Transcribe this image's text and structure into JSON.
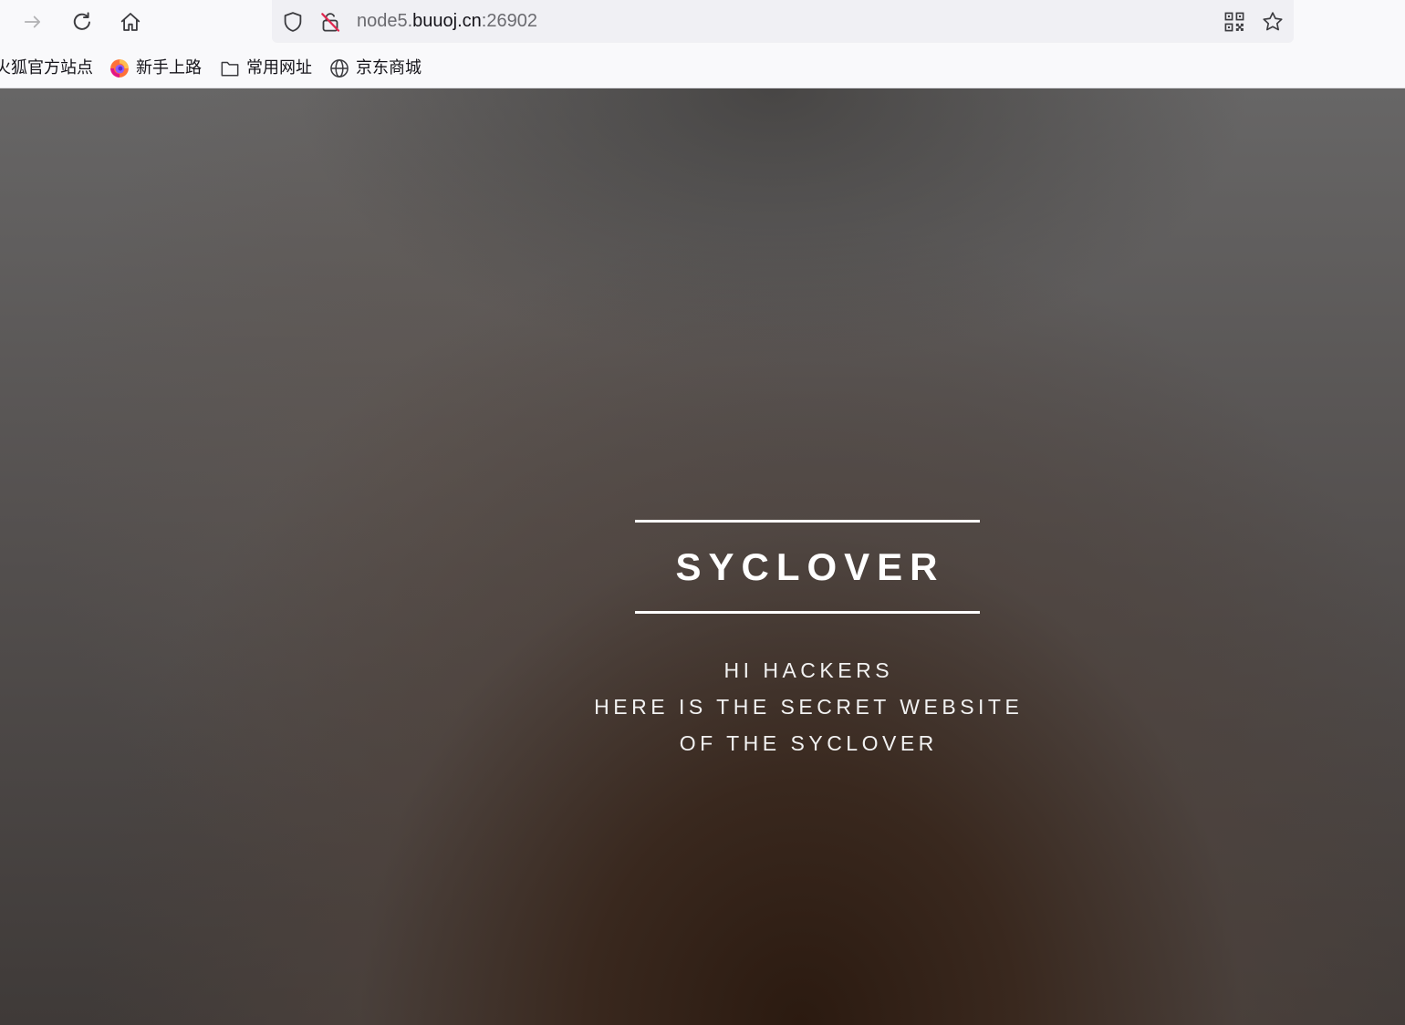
{
  "toolbar": {
    "forward": {
      "icon": "arrow-right-icon",
      "enabled": false
    },
    "reload": {
      "icon": "reload-icon"
    },
    "home": {
      "icon": "home-icon"
    }
  },
  "urlbar": {
    "tracking_icon": "shield-icon",
    "security_icon": "insecure-lock-icon",
    "url": {
      "subdomain": "node5.",
      "domain": "buuoj.cn",
      "port": ":26902"
    },
    "qr_icon": "qr-code-icon",
    "bookmark_icon": "star-icon"
  },
  "bookmarks": [
    {
      "label": "火狐官方站点"
    },
    {
      "label": "新手上路",
      "icon": "firefox-icon"
    },
    {
      "label": "常用网址",
      "icon": "folder-icon"
    },
    {
      "label": "京东商城",
      "icon": "globe-icon"
    }
  ],
  "page": {
    "title": "SYCLOVER",
    "lines": [
      "HI HACKERS",
      "HERE IS THE SECRET WEBSITE",
      "OF THE SYCLOVER"
    ]
  },
  "colors": {
    "chrome_background": "#f9f9fb",
    "urlbar_background": "#f0f0f4",
    "icon": "#3b3b3f",
    "icon_disabled": "#b1b1b3",
    "insecure_slash": "#e22850",
    "page_dark_brown": "#2b1a10",
    "page_edge_grey": "#676666",
    "page_text": "#ffffff"
  }
}
